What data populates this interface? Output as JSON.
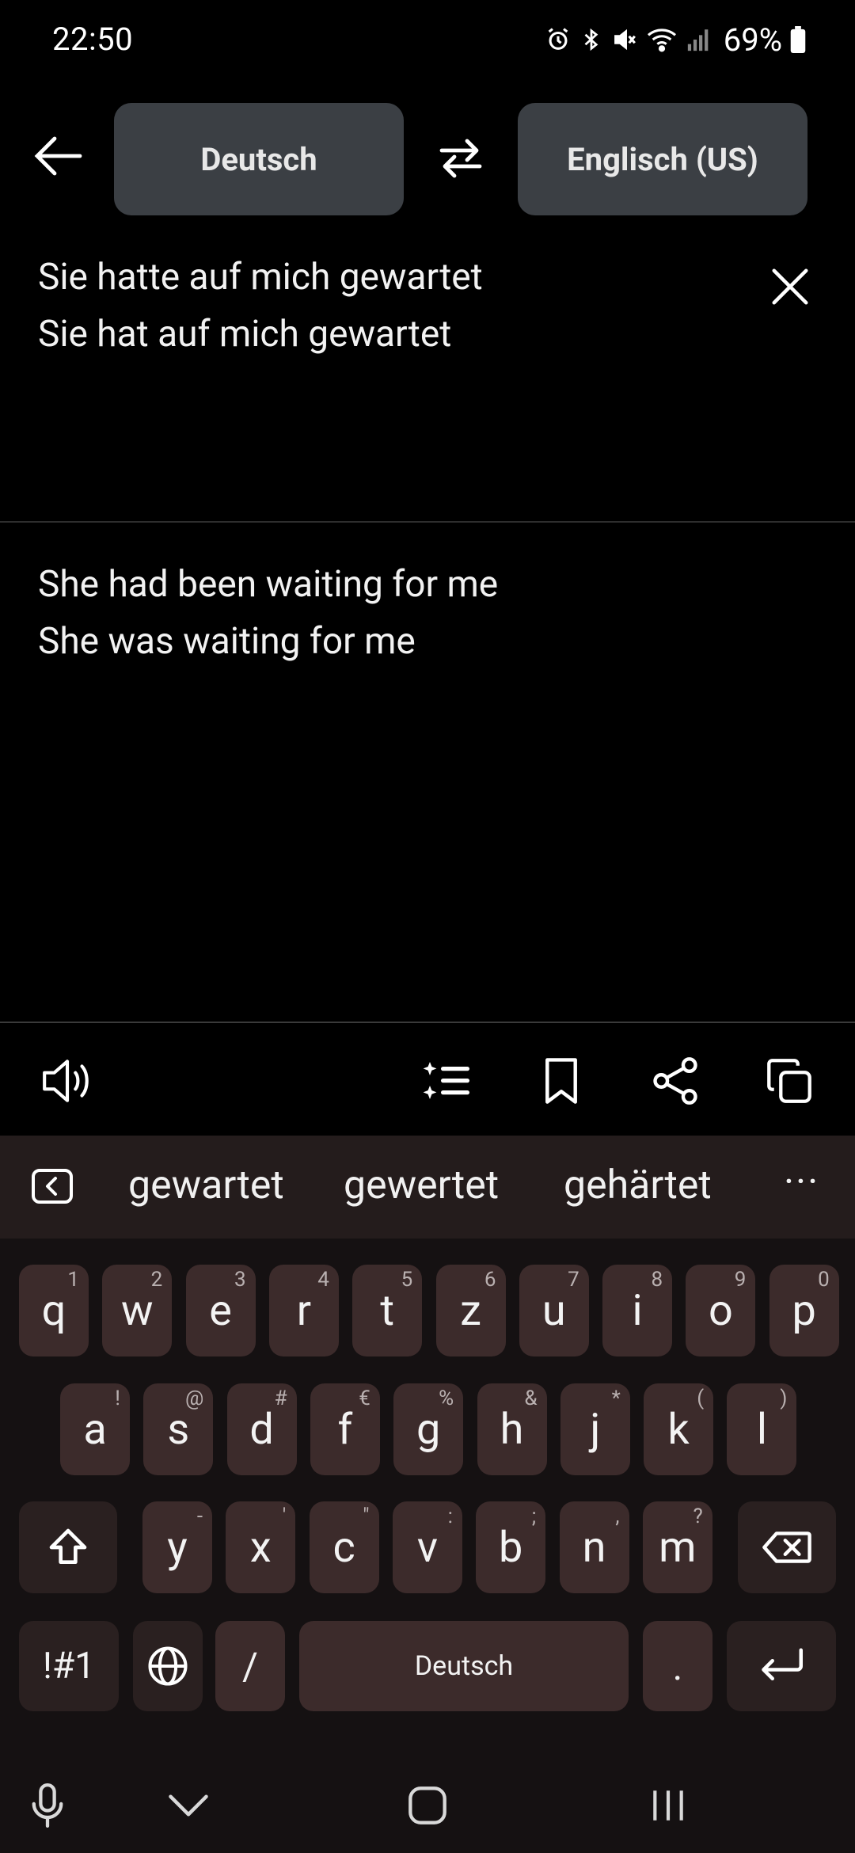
{
  "status_bar": {
    "time": "22:50",
    "icons": [
      "alarm-icon",
      "bluetooth-icon",
      "mute-icon",
      "wifi-icon",
      "signal-icon"
    ],
    "battery_percent": "69%"
  },
  "header": {
    "source_language": "Deutsch",
    "target_language": "Englisch (US)"
  },
  "source": {
    "lines": [
      "Sie hatte auf mich gewartet",
      "Sie hat auf mich gewartet"
    ]
  },
  "translation": {
    "lines": [
      "She had been waiting for me",
      "She was waiting for me"
    ]
  },
  "actions": [
    "speaker-icon",
    "ai-list-icon",
    "bookmark-icon",
    "share-icon",
    "copy-icon"
  ],
  "keyboard": {
    "suggestions": [
      "gewartet",
      "gewertet",
      "gehärtet"
    ],
    "more": "···",
    "rows": [
      [
        {
          "k": "q",
          "h": "1"
        },
        {
          "k": "w",
          "h": "2"
        },
        {
          "k": "e",
          "h": "3"
        },
        {
          "k": "r",
          "h": "4"
        },
        {
          "k": "t",
          "h": "5"
        },
        {
          "k": "z",
          "h": "6"
        },
        {
          "k": "u",
          "h": "7"
        },
        {
          "k": "i",
          "h": "8"
        },
        {
          "k": "o",
          "h": "9"
        },
        {
          "k": "p",
          "h": "0"
        }
      ],
      [
        {
          "k": "a",
          "h": "!"
        },
        {
          "k": "s",
          "h": "@"
        },
        {
          "k": "d",
          "h": "#"
        },
        {
          "k": "f",
          "h": "€"
        },
        {
          "k": "g",
          "h": "%"
        },
        {
          "k": "h",
          "h": "&"
        },
        {
          "k": "j",
          "h": "*"
        },
        {
          "k": "k",
          "h": "("
        },
        {
          "k": "l",
          "h": ")"
        }
      ],
      [
        {
          "k": "y",
          "h": "-"
        },
        {
          "k": "x",
          "h": "'"
        },
        {
          "k": "c",
          "h": "\""
        },
        {
          "k": "v",
          "h": ":"
        },
        {
          "k": "b",
          "h": ";"
        },
        {
          "k": "n",
          "h": ","
        },
        {
          "k": "m",
          "h": "?"
        }
      ]
    ],
    "symbols_key": "!#1",
    "slash_key": "/",
    "space_label": "Deutsch",
    "period_key": "."
  }
}
